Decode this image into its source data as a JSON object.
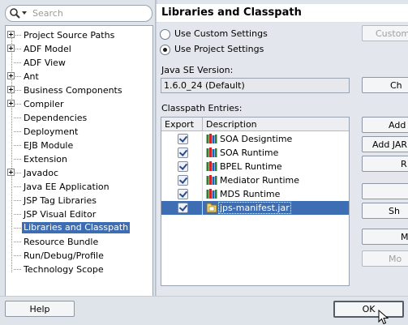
{
  "search": {
    "placeholder": "Search"
  },
  "nav_items": [
    {
      "label": "Project Source Paths",
      "expandable": true
    },
    {
      "label": "ADF Model",
      "expandable": true
    },
    {
      "label": "ADF View",
      "expandable": false
    },
    {
      "label": "Ant",
      "expandable": true
    },
    {
      "label": "Business Components",
      "expandable": true
    },
    {
      "label": "Compiler",
      "expandable": true
    },
    {
      "label": "Dependencies",
      "expandable": false
    },
    {
      "label": "Deployment",
      "expandable": false
    },
    {
      "label": "EJB Module",
      "expandable": false
    },
    {
      "label": "Extension",
      "expandable": false
    },
    {
      "label": "Javadoc",
      "expandable": true
    },
    {
      "label": "Java EE Application",
      "expandable": false
    },
    {
      "label": "JSP Tag Libraries",
      "expandable": false
    },
    {
      "label": "JSP Visual Editor",
      "expandable": false
    },
    {
      "label": "Libraries and Classpath",
      "expandable": false,
      "selected": true
    },
    {
      "label": "Resource Bundle",
      "expandable": false
    },
    {
      "label": "Run/Debug/Profile",
      "expandable": false
    },
    {
      "label": "Technology Scope",
      "expandable": false
    }
  ],
  "page_title": "Libraries and Classpath",
  "settings": {
    "custom_label": "Use Custom Settings",
    "project_label": "Use Project Settings",
    "selected": "project",
    "customize_button": "Custom"
  },
  "java_se": {
    "label": "Java SE Version:",
    "value": "1.6.0_24 (Default)",
    "change_button": "Ch"
  },
  "classpath": {
    "label": "Classpath Entries:",
    "columns": [
      "Export",
      "Description"
    ],
    "rows": [
      {
        "name": "SOA Designtime",
        "exported": true,
        "icon": "library-books-icon"
      },
      {
        "name": "SOA Runtime",
        "exported": true,
        "icon": "library-books-icon"
      },
      {
        "name": "BPEL Runtime",
        "exported": true,
        "icon": "library-books-icon"
      },
      {
        "name": "Mediator Runtime",
        "exported": true,
        "icon": "library-books-icon"
      },
      {
        "name": "MDS Runtime",
        "exported": true,
        "icon": "library-books-icon"
      },
      {
        "name": "jps-manifest.jar",
        "exported": true,
        "icon": "jar-file-icon",
        "selected": true
      }
    ]
  },
  "side_buttons": [
    {
      "label": "Add",
      "enabled": true
    },
    {
      "label": "Add JAR",
      "enabled": true
    },
    {
      "label": "R",
      "enabled": true
    },
    {
      "label": "",
      "enabled": true
    },
    {
      "label": "Sh",
      "enabled": true
    },
    {
      "label": "M",
      "enabled": true
    },
    {
      "label": "Mo",
      "enabled": false
    }
  ],
  "footer": {
    "help_label": "Help",
    "ok_label": "OK"
  },
  "colors": {
    "selection": "#3d6eb3",
    "panel": "#e3e6ec",
    "window": "#dfe3ea"
  }
}
